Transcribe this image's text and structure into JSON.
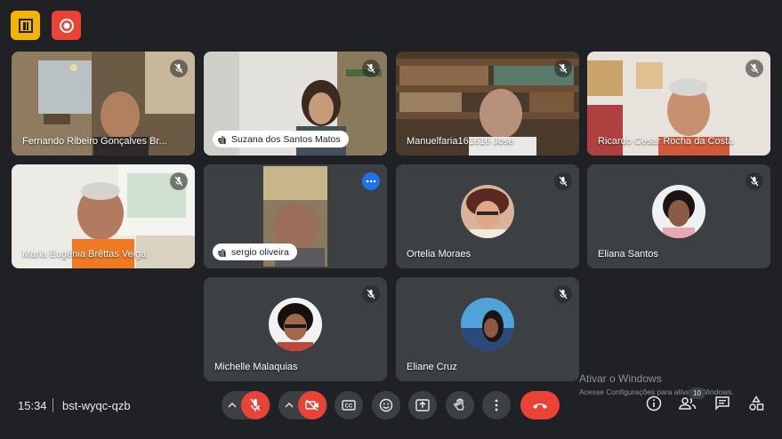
{
  "top": {
    "logo_icon": "brand-logo-icon",
    "record_icon": "record-icon"
  },
  "tiles": [
    {
      "name": "Fernando Ribeiro Gonçalves Br...",
      "muted": true
    },
    {
      "name": "Suzana dos Santos Matos",
      "muted": true,
      "speaking": true
    },
    {
      "name": "Manuelfaria161616 Jose",
      "muted": true
    },
    {
      "name": "Ricardo Cesar Rocha da Costa",
      "muted": true
    },
    {
      "name": "Maria Eugênia Brêttas Veiga",
      "muted": true
    },
    {
      "name": "sergio oliveira",
      "muted": false,
      "speaking": true,
      "active": true
    },
    {
      "name": "Ortelia Moraes",
      "muted": true
    },
    {
      "name": "Eliana Santos",
      "muted": true
    },
    {
      "name": "Michelle Malaquias",
      "muted": true
    },
    {
      "name": "Eliane Cruz",
      "muted": true
    }
  ],
  "bottom": {
    "time": "15:34",
    "meeting_code": "bst-wyqc-qzb",
    "participants_count": "10"
  },
  "watermark": {
    "title": "Ativar o Windows",
    "subtitle": "Acesse Configurações para ativar o Windows."
  },
  "colors": {
    "accent": "#8ab4f8",
    "danger": "#ea4335",
    "bg": "#202124",
    "tile": "#3c4043",
    "brand": "#f5b400"
  }
}
